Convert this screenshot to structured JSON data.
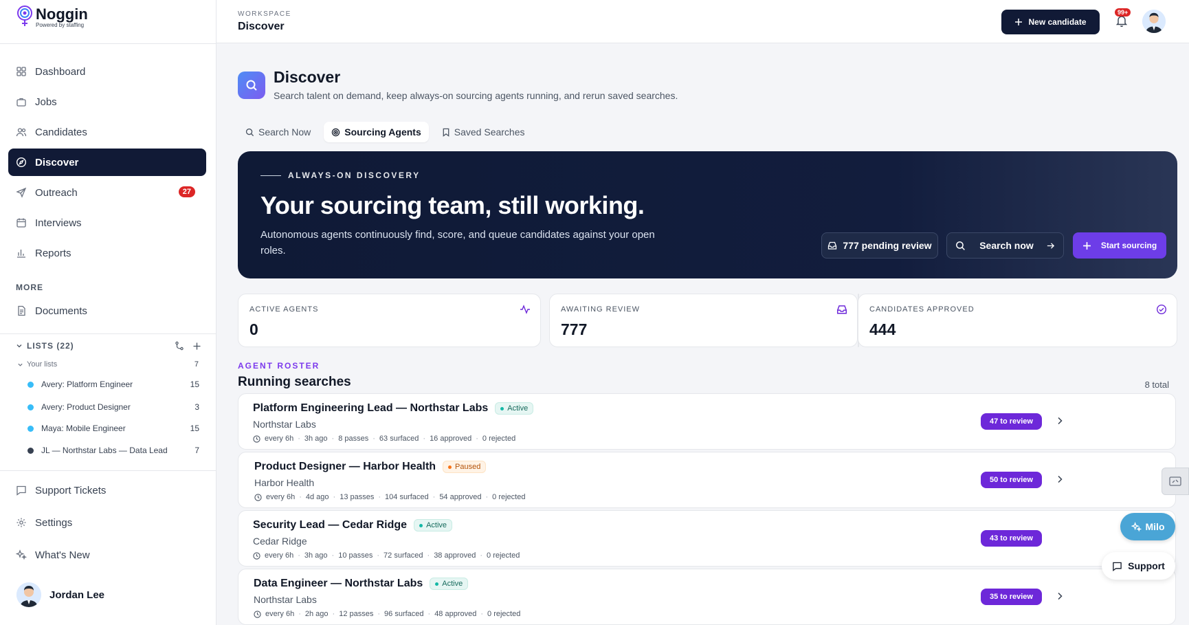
{
  "app": {
    "name": "Noggin",
    "tagline": "Powered by staffing"
  },
  "nav": {
    "items": [
      {
        "label": "Dashboard",
        "icon": "grid-icon"
      },
      {
        "label": "Jobs",
        "icon": "briefcase-icon"
      },
      {
        "label": "Candidates",
        "icon": "users-icon"
      },
      {
        "label": "Discover",
        "icon": "compass-icon",
        "active": true
      },
      {
        "label": "Outreach",
        "icon": "send-icon",
        "badge": "27"
      },
      {
        "label": "Interviews",
        "icon": "calendar-icon"
      },
      {
        "label": "Reports",
        "icon": "bar-chart-icon"
      }
    ],
    "more_label": "MORE",
    "documents": "Documents",
    "lists_label": "LISTS (22)",
    "your_lists": {
      "label": "Your lists",
      "count": "7"
    },
    "lists": [
      {
        "label": "Avery: Platform Engineer",
        "count": "15",
        "color": "#38bdf8"
      },
      {
        "label": "Avery: Product Designer",
        "count": "3",
        "color": "#38bdf8"
      },
      {
        "label": "Maya: Mobile Engineer",
        "count": "15",
        "color": "#38bdf8"
      },
      {
        "label": "JL — Northstar Labs — Data Lead",
        "count": "7",
        "color": "#374151"
      }
    ],
    "support_tickets": "Support Tickets",
    "settings": "Settings",
    "whats_new": "What's New",
    "user_name": "Jordan Lee"
  },
  "topbar": {
    "workspace_label": "WORKSPACE",
    "workspace_title": "Discover",
    "new_candidate": "New candidate",
    "notif_badge": "99+"
  },
  "page": {
    "title": "Discover",
    "subtitle": "Search talent on demand, keep always-on sourcing agents running, and rerun saved searches.",
    "tabs": [
      {
        "label": "Search Now",
        "icon": "search-icon"
      },
      {
        "label": "Sourcing Agents",
        "icon": "target-icon",
        "active": true
      },
      {
        "label": "Saved Searches",
        "icon": "bookmark-icon"
      }
    ]
  },
  "hero": {
    "eyebrow": "ALWAYS-ON DISCOVERY",
    "title": "Your sourcing team, still working.",
    "description": "Autonomous agents continuously find, score, and queue candidates against your open roles.",
    "pending": "777 pending review",
    "search_now": "Search now",
    "start_sourcing": "Start sourcing"
  },
  "stats": [
    {
      "label": "ACTIVE AGENTS",
      "value": "0",
      "icon": "activity-icon"
    },
    {
      "label": "AWAITING REVIEW",
      "value": "777",
      "icon": "inbox-icon"
    },
    {
      "label": "CANDIDATES APPROVED",
      "value": "444",
      "icon": "check-circle-icon"
    }
  ],
  "roster": {
    "eyebrow": "AGENT ROSTER",
    "title": "Running searches",
    "total": "8 total",
    "rows": [
      {
        "title": "Platform Engineering Lead — Northstar Labs",
        "status": "Active",
        "company": "Northstar Labs",
        "every": "every 6h",
        "ago": "3h ago",
        "passes": "8 passes",
        "surfaced": "63 surfaced",
        "approved": "16 approved",
        "rejected": "0 rejected",
        "review": "47 to review"
      },
      {
        "title": "Product Designer — Harbor Health",
        "status": "Paused",
        "company": "Harbor Health",
        "every": "every 6h",
        "ago": "4d ago",
        "passes": "13 passes",
        "surfaced": "104 surfaced",
        "approved": "54 approved",
        "rejected": "0 rejected",
        "review": "50 to review"
      },
      {
        "title": "Security Lead — Cedar Ridge",
        "status": "Active",
        "company": "Cedar Ridge",
        "every": "every 6h",
        "ago": "3h ago",
        "passes": "10 passes",
        "surfaced": "72 surfaced",
        "approved": "38 approved",
        "rejected": "0 rejected",
        "review": "43 to review"
      },
      {
        "title": "Data Engineer — Northstar Labs",
        "status": "Active",
        "company": "Northstar Labs",
        "every": "every 6h",
        "ago": "2h ago",
        "passes": "12 passes",
        "surfaced": "96 surfaced",
        "approved": "48 approved",
        "rejected": "0 rejected",
        "review": "35 to review"
      }
    ]
  },
  "floating": {
    "milo": "Milo",
    "support": "Support"
  }
}
